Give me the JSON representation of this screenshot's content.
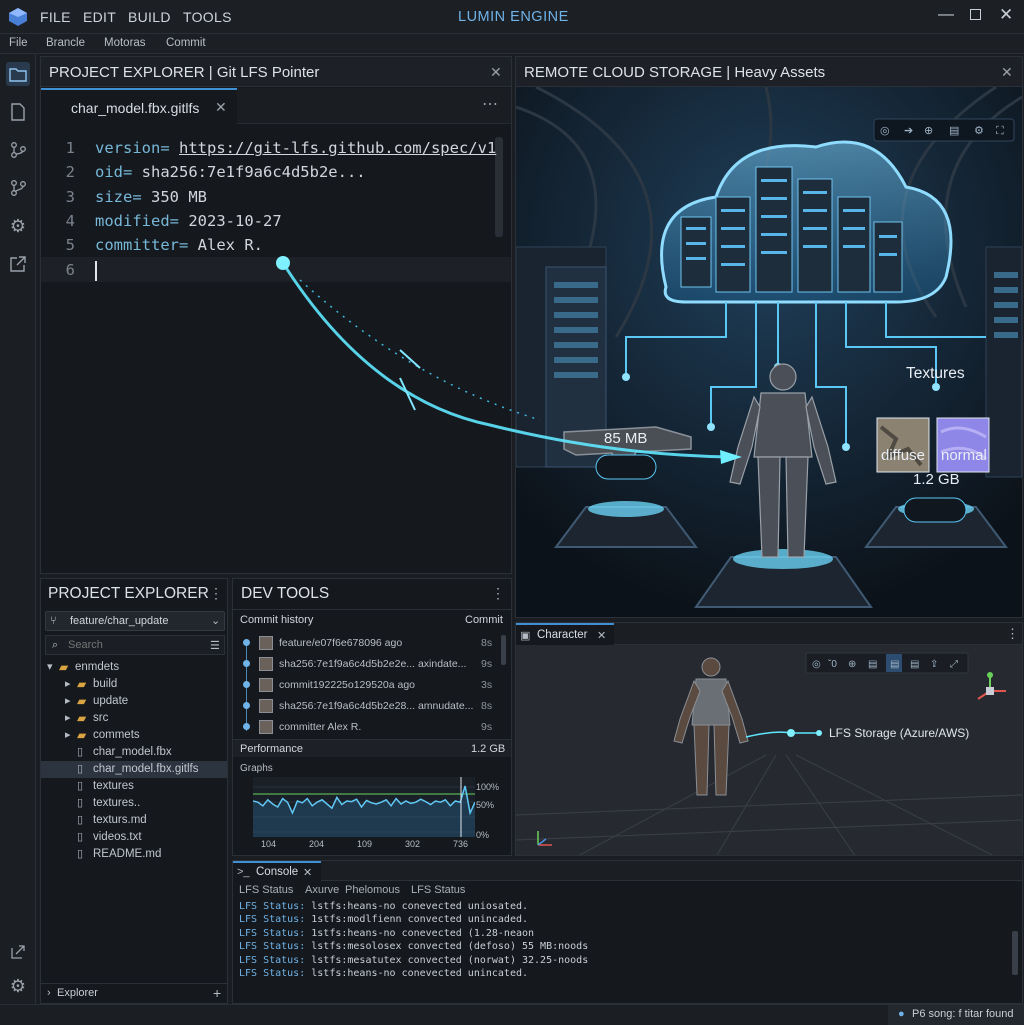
{
  "window": {
    "title": "LUMIN ENGINE",
    "menus": [
      "FILE",
      "EDIT",
      "BUILD",
      "TOOLS"
    ],
    "submenus": [
      "File",
      "Brancle",
      "Motoras",
      "Commit"
    ]
  },
  "editor": {
    "panel_title": "PROJECT EXPLORER | Git LFS Pointer",
    "tab": "char_model.fbx.gitlfs",
    "lines": [
      {
        "n": "1",
        "k": "version=",
        "v": "https://git-lfs.github.com/spec/v1"
      },
      {
        "n": "2",
        "k": "oid=",
        "v": "sha256:7e1f9a6c4d5b2e..."
      },
      {
        "n": "3",
        "k": "size=",
        "v": "350 MB"
      },
      {
        "n": "4",
        "k": "modified=",
        "v": "2023-10-27"
      },
      {
        "n": "5",
        "k": "committer=",
        "v": "Alex R."
      },
      {
        "n": "6",
        "k": "",
        "v": ""
      }
    ]
  },
  "cloud": {
    "panel_title": "REMOTE CLOUD STORAGE | Heavy Assets",
    "weapon_size": "85 MB",
    "textures_label": "Textures",
    "diffuse": "diffuse",
    "normal": "normal",
    "textures_size": "1.2 GB"
  },
  "explorer": {
    "title": "PROJECT EXPLORER",
    "branch": "feature/char_update",
    "search_placeholder": "Search",
    "items": [
      {
        "label": "enmdets",
        "type": "folder-open",
        "depth": 0
      },
      {
        "label": "build",
        "type": "folder",
        "depth": 1
      },
      {
        "label": "update",
        "type": "folder",
        "depth": 1
      },
      {
        "label": "src",
        "type": "folder",
        "depth": 1
      },
      {
        "label": "commets",
        "type": "folder",
        "depth": 1
      },
      {
        "label": "char_model.fbx",
        "type": "file",
        "depth": 1
      },
      {
        "label": "char_model.fbx.gitlfs",
        "type": "file",
        "depth": 1,
        "selected": true
      },
      {
        "label": "textures",
        "type": "file",
        "depth": 1
      },
      {
        "label": "textures..",
        "type": "file",
        "depth": 1
      },
      {
        "label": "texturs.md",
        "type": "file",
        "depth": 1
      },
      {
        "label": "videos.txt",
        "type": "file",
        "depth": 1
      },
      {
        "label": "README.md",
        "type": "file",
        "depth": 1
      }
    ],
    "footer": "Explorer"
  },
  "devtools": {
    "title": "DEV TOOLS",
    "commit_history": "Commit history",
    "commit_col": "Commit",
    "commits": [
      {
        "msg": "feature/e07f6e678096 ago",
        "time": "8s"
      },
      {
        "msg": "sha256:7e1f9a6c4d5b2e2e... axindate...",
        "time": "9s"
      },
      {
        "msg": "commit192225o129520a ago",
        "time": "3s"
      },
      {
        "msg": "sha256:7e1f9a6c4d5b2e28... amnudate...",
        "time": "8s"
      },
      {
        "msg": "committer Alex R.",
        "time": "9s"
      }
    ],
    "performance": "Performance",
    "perf_value": "1.2 GB",
    "graphs": "Graphs",
    "y_labels": [
      "100%",
      "50%",
      "0%"
    ],
    "x_labels": [
      "104",
      "204",
      "109",
      "302",
      "736"
    ],
    "graph_values": [
      60,
      58,
      52,
      62,
      55,
      50,
      64,
      58,
      40,
      60,
      57,
      64,
      52,
      58,
      62,
      55,
      48,
      66,
      54,
      60,
      59,
      63,
      50,
      61,
      57,
      55,
      58,
      62,
      52,
      64,
      55,
      60,
      56,
      58,
      63,
      59,
      54,
      60,
      58,
      62,
      52,
      60,
      58,
      85,
      40,
      58
    ]
  },
  "character": {
    "tab": "Character",
    "lfs_label": "LFS Storage (Azure/AWS)"
  },
  "console": {
    "tab": "Console",
    "tabs": [
      "LFS Status",
      "Axurve",
      "Phelomous",
      "LFS Status"
    ],
    "lines": [
      {
        "p": "LFS Status:",
        "t": "lstfs:heans-no conevected uniosated."
      },
      {
        "p": "LFS Status:",
        "t": "1stfs:modlfienn convected unincaded."
      },
      {
        "p": "LFS Status:",
        "t": "1stfs:heans-no conevected (1.28-neaon"
      },
      {
        "p": "LFS Status:",
        "t": "lstfs:mesolosex convected (defoso) 55 MB:noods"
      },
      {
        "p": "LFS Status:",
        "t": "lstfs:mesatutex convected (norwat) 32.25-noods"
      },
      {
        "p": "LFS Status:",
        "t": "lstfs:heans-no conevected unincated."
      }
    ]
  },
  "status": {
    "text": "P6 song: f titar found"
  }
}
